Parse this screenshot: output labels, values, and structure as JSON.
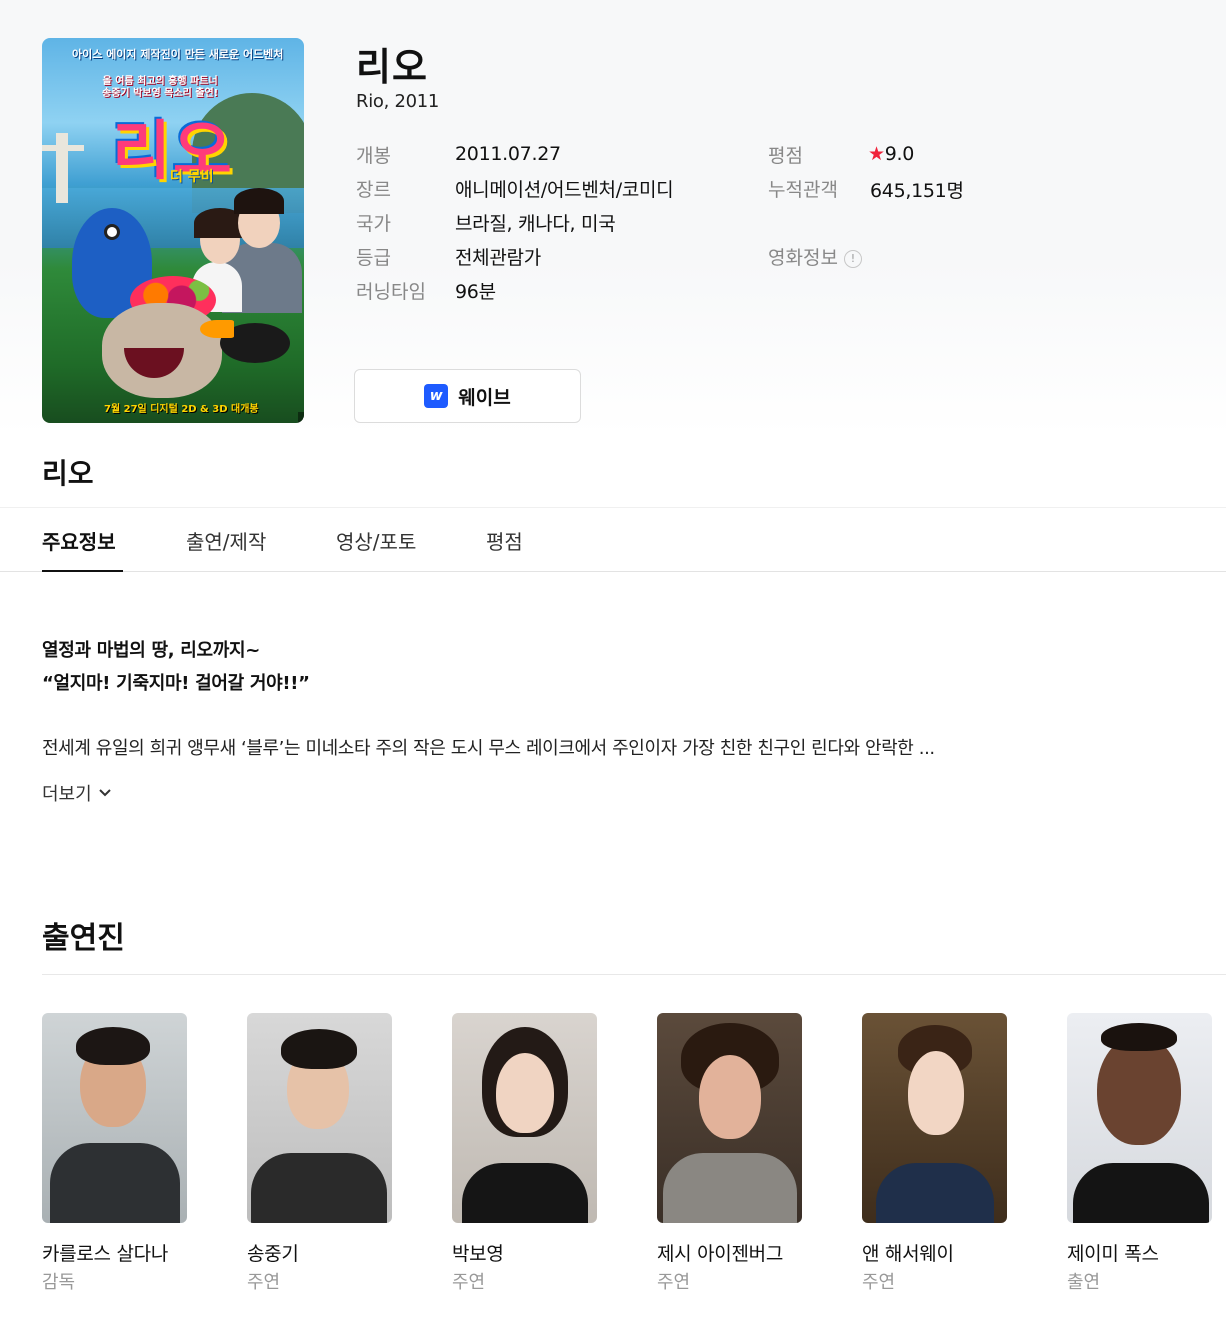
{
  "movie": {
    "title": "리오",
    "subtitle": "Rio, 2011",
    "section_title": "리오"
  },
  "poster": {
    "head_copy": "아이스 에이지 제작진이 만든 새로운 어드벤처",
    "tag_copy_1": "올 여름 최고의 흥행 파트너",
    "tag_copy_2": "송중기 박보영 목소리 출연!",
    "logo": "리오",
    "logo_sub": "더 무비",
    "date_copy": "7월 27일 디지털 2D & 3D 대개봉"
  },
  "info_left": [
    {
      "label": "개봉",
      "value": "2011.07.27"
    },
    {
      "label": "장르",
      "value": "애니메이션/어드벤처/코미디"
    },
    {
      "label": "국가",
      "value": "브라질, 캐나다, 미국"
    },
    {
      "label": "등급",
      "value": "전체관람가"
    },
    {
      "label": "러닝타임",
      "value": "96분"
    }
  ],
  "info_right": {
    "rating_label": "평점",
    "rating_star": "★",
    "rating_value": "9.0",
    "audience_label": "누적관객",
    "audience_value": "645,151명",
    "movieinfo_label": "영화정보",
    "movieinfo_icon": "!"
  },
  "ott": {
    "logo": "w",
    "label": "웨이브"
  },
  "tabs": [
    {
      "label": "주요정보",
      "active": true
    },
    {
      "label": "출연/제작",
      "active": false
    },
    {
      "label": "영상/포토",
      "active": false
    },
    {
      "label": "평점",
      "active": false
    }
  ],
  "synopsis": {
    "tagline_1": "열정과 마법의 땅, 리오까지~",
    "tagline_2": "“얼지마! 기죽지마! 걸어갈 거야!!”",
    "body": "전세계 유일의 희귀 앵무새 ‘블루’는 미네소타 주의 작은 도시 무스 레이크에서 주인이자 가장 친한 친구인 린다와 안락한 ...",
    "more_label": "더보기"
  },
  "cast": {
    "heading": "출연진",
    "members": [
      {
        "name": "카를로스 살다나",
        "role": "감독"
      },
      {
        "name": "송중기",
        "role": "주연"
      },
      {
        "name": "박보영",
        "role": "주연"
      },
      {
        "name": "제시 아이젠버그",
        "role": "주연"
      },
      {
        "name": "앤 해서웨이",
        "role": "주연"
      },
      {
        "name": "제이미 폭스",
        "role": "출연"
      }
    ]
  },
  "colors": {
    "accent_star": "#f0233b",
    "wavve_brand": "#1e5bff",
    "label_gray": "#888888"
  },
  "icons": {
    "expand": "expand-icon",
    "chevron": "chevron-down-icon",
    "info": "info-icon",
    "star": "star-icon"
  }
}
